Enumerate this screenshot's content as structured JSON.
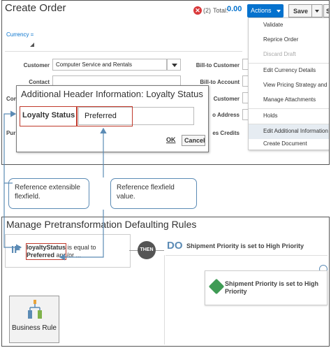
{
  "header": {
    "title": "Create Order",
    "error_count": "(2)",
    "total_label": "Total:",
    "total_value": "0.00",
    "actions_label": "Actions",
    "save_label": "Save",
    "extra_label": "S"
  },
  "form": {
    "currency_link": "Currency =",
    "customer_label": "Customer",
    "customer_value": "Computer Service and Rentals",
    "contact_label": "Contact",
    "con_label": "Con",
    "pur_label": "Pur",
    "bill_customer_label": "Bill-to Customer",
    "bill_account_label": "Bill-to Account",
    "ship_customer_label": "Customer",
    "ship_address_label": "o Address",
    "credits_label": "es Credits"
  },
  "actions_menu": {
    "items": [
      {
        "label": "Validate",
        "state": "normal"
      },
      {
        "label": "Reprice Order",
        "state": "normal"
      },
      {
        "label": "Discard Draft",
        "state": "disabled"
      },
      {
        "label": "Edit Currency Details",
        "state": "normal"
      },
      {
        "label": "View Pricing Strategy and S",
        "state": "normal"
      },
      {
        "label": "Manage Attachments",
        "state": "normal"
      },
      {
        "label": "Holds",
        "state": "normal"
      },
      {
        "label": "Edit Additional Information",
        "state": "highlight"
      },
      {
        "label": "Create Document",
        "state": "normal"
      }
    ]
  },
  "dialog": {
    "title": "Additional Header Information: Loyalty Status",
    "field_label": "Loyalty Status",
    "field_value": "Preferred",
    "ok_label": "OK",
    "cancel_label": "Cancel"
  },
  "callouts": {
    "left": "Reference extensible flexfield.",
    "right": "Reference  flexfield value."
  },
  "rules": {
    "title": "Manage Pretransformation Defaulting Rules",
    "if_label": "IF",
    "if_variable": "loyaltyStatus",
    "if_operator": " is equal to",
    "if_value": "Preferred",
    "if_rest": " and/or ...",
    "then_label": "THEN",
    "do_label": "DO",
    "do_text": "Shipment Priority is set to High Priority",
    "action_text": "Shipment Priority is set to High Priority",
    "business_rule_label": "Business Rule"
  },
  "colors": {
    "accent": "#0572ce",
    "highlight_border": "#c0392b",
    "callout_border": "#5b8bb5",
    "error": "#d9383a",
    "tag_green": "#3f9b55"
  }
}
